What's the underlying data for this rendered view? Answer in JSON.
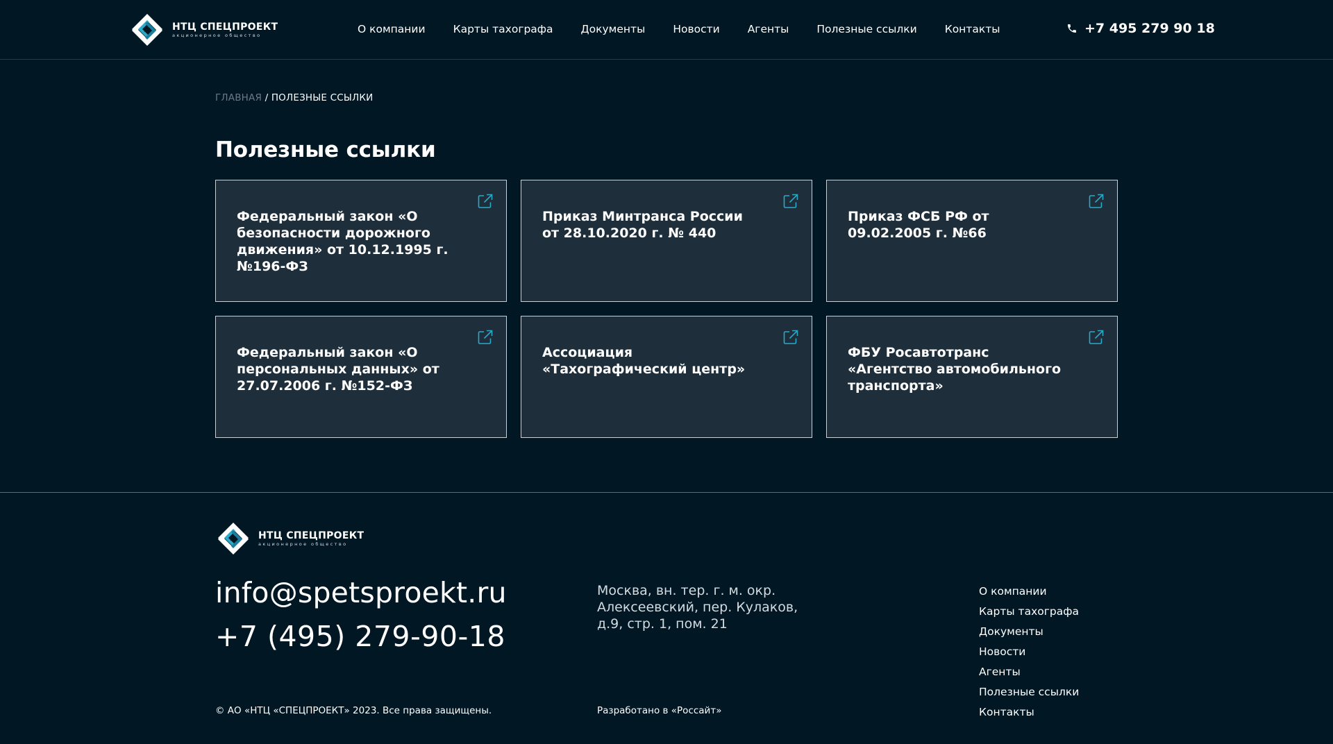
{
  "colors": {
    "background": "#011724",
    "card_background": "#1e2f3b",
    "card_border": "#c9d1d7",
    "accent_icon": "#2aa9c9",
    "breadcrumb_muted": "#6b7b86"
  },
  "header": {
    "logo": {
      "name": "НТЦ СПЕЦПРОЕКТ",
      "subtitle": "акционерное общество",
      "icon": "spetsproekt-logo-icon"
    },
    "nav": [
      {
        "label": "О компании"
      },
      {
        "label": "Карты тахографа"
      },
      {
        "label": "Документы"
      },
      {
        "label": "Новости"
      },
      {
        "label": "Агенты"
      },
      {
        "label": "Полезные ссылки"
      },
      {
        "label": "Контакты"
      }
    ],
    "phone": {
      "icon": "phone-icon",
      "label": "+7 495 279 90 18"
    }
  },
  "breadcrumb": {
    "home": "ГЛАВНАЯ",
    "separator": "/",
    "current": "ПОЛЕЗНЫЕ ССЫЛКИ"
  },
  "page_title": "Полезные ссылки",
  "cards": [
    {
      "text": "Федеральный закон «О безопасности дорожного движения» от 10.12.1995 г. №196-ФЗ",
      "icon": "external-link-icon"
    },
    {
      "text": "Приказ Минтранса России от 28.10.2020 г. № 440",
      "icon": "external-link-icon"
    },
    {
      "text": "Приказ ФСБ РФ от 09.02.2005 г. №66",
      "icon": "external-link-icon"
    },
    {
      "text": "Федеральный закон «О персональных данных» от 27.07.2006 г. №152-ФЗ",
      "icon": "external-link-icon"
    },
    {
      "text": "Ассоциация «Тахографический центр»",
      "icon": "external-link-icon"
    },
    {
      "text": "ФБУ Росавтотранс «Агентство автомобильного транспорта»",
      "icon": "external-link-icon"
    }
  ],
  "footer": {
    "logo": {
      "name": "НТЦ СПЕЦПРОЕКТ",
      "subtitle": "акционерное общество"
    },
    "email": "info@spetsproekt.ru",
    "phone": "+7 (495) 279-90-18",
    "address": "Москва, вн. тер. г. м. окр. Алексеевский, пер. Кулаков, д.9, стр. 1, пом. 21",
    "nav": [
      {
        "label": "О компании"
      },
      {
        "label": "Карты тахографа"
      },
      {
        "label": "Документы"
      },
      {
        "label": "Новости"
      },
      {
        "label": "Агенты"
      },
      {
        "label": "Полезные ссылки"
      },
      {
        "label": "Контакты"
      }
    ],
    "copyright": "© АО «НТЦ «СПЕЦПРОЕКТ» 2023. Все права защищены.",
    "developer": "Разработано в «Россайт»"
  }
}
